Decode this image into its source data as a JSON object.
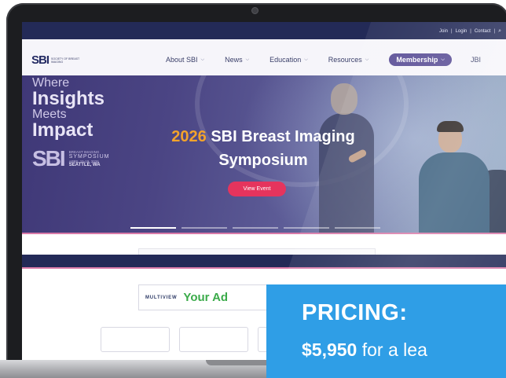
{
  "topbar": {
    "links": [
      "Join",
      "Login",
      "Contact"
    ]
  },
  "logo": {
    "mark": "SBI",
    "text": "SOCIETY OF BREAST IMAGING"
  },
  "nav": {
    "items": [
      {
        "label": "About SBI"
      },
      {
        "label": "News"
      },
      {
        "label": "Education"
      },
      {
        "label": "Resources"
      }
    ],
    "membership": "Membership",
    "jbi": "JBI"
  },
  "hero": {
    "left": {
      "where": "Where",
      "insights": "Insights",
      "meets": "Meets",
      "impact": "Impact",
      "sbi": "SBI",
      "symposium_line1": "BREAST IMAGING",
      "symposium_line2": "SYMPOSIUM",
      "dates": "APRIL 15-19, 2026",
      "city": "SEATTLE, WA"
    },
    "year": "2026",
    "title_rest": "SBI Breast Imaging",
    "title_line2": "Symposium",
    "cta": "View Event"
  },
  "ad": {
    "logo": "MULTIVIEW",
    "text": "Your Ad"
  },
  "pricing": {
    "title": "PRICING:",
    "price": "$5,950",
    "suffix": "for a lea"
  },
  "colors": {
    "navy": "#232a57",
    "membership": "#5a4e96",
    "cta": "#e5345d",
    "year": "#f3a32b",
    "pricing_bg": "#2f9ee6",
    "ad_green": "#3bab4a"
  }
}
